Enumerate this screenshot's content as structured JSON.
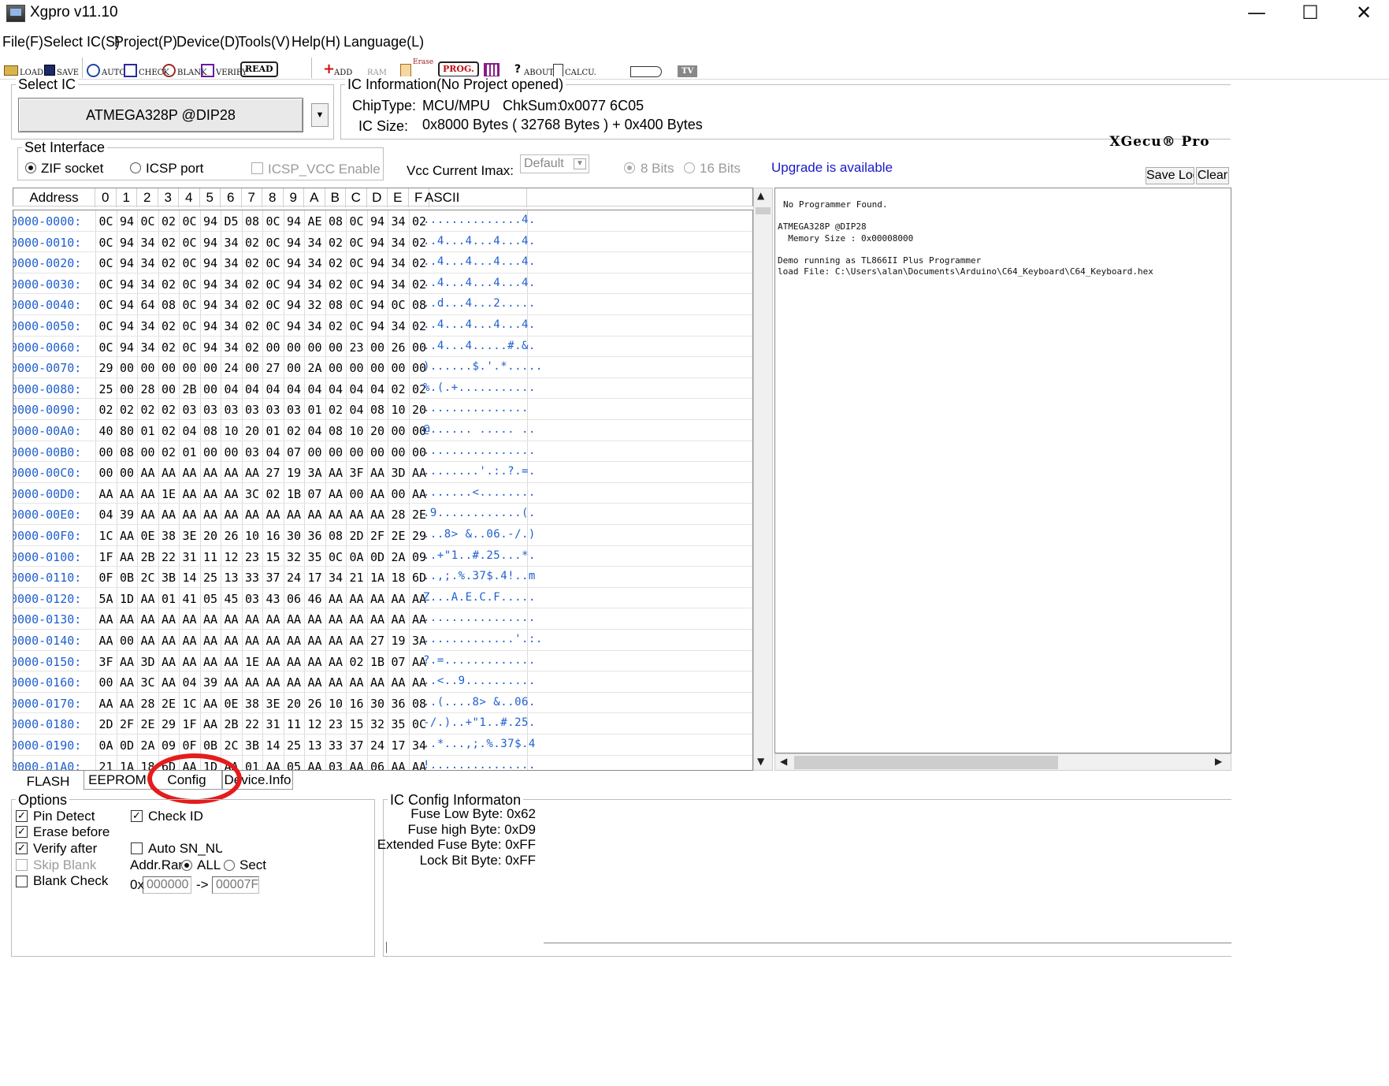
{
  "window": {
    "title": "Xgpro v11.10",
    "min": "—",
    "max": "☐",
    "close": "✕"
  },
  "menu": [
    "File(F)",
    "Select IC(S)",
    "Project(P)",
    "Device(D)",
    "Tools(V)",
    "Help(H)",
    "Language(L)"
  ],
  "toolbar": {
    "load": "LOAD",
    "save": "SAVE",
    "auto": "AUTO",
    "check": "CHECK",
    "blank": "BLANK",
    "verify": "VERIFY",
    "read": "READ",
    "add": "ADD",
    "ram": "RAM",
    "erase": "Erase",
    "prog": "PROG.",
    "about": "ABOUT",
    "calcu": "CALCU.",
    "tv": "TV"
  },
  "select_ic": {
    "title": "Select IC",
    "device": "ATMEGA328P @DIP28",
    "arrow": "▼"
  },
  "ic_info": {
    "title": "IC Information(No Project opened)",
    "chiptype_label": "ChipType:",
    "chiptype": "MCU/MPU",
    "chksum_label": "ChkSum:",
    "chksum": "0x0077 6C05",
    "size_label": "IC Size:",
    "size": "0x8000 Bytes ( 32768 Bytes ) + 0x400 Bytes"
  },
  "brand": "XGecu® Pro",
  "interface": {
    "title": "Set Interface",
    "zif": "ZIF socket",
    "icsp": "ICSP port",
    "icsp_vcc": "ICSP_VCC Enable",
    "vcc_label": "Vcc Current Imax:",
    "vcc_value": "Default",
    "bits8": "8 Bits",
    "bits16": "16 Bits"
  },
  "upgrade": "Upgrade is available",
  "log_buttons": {
    "save": "Save Log",
    "clear": "Clear"
  },
  "hex": {
    "headers": [
      "Address",
      "0",
      "1",
      "2",
      "3",
      "4",
      "5",
      "6",
      "7",
      "8",
      "9",
      "A",
      "B",
      "C",
      "D",
      "E",
      "F",
      "ASCII"
    ],
    "rows": [
      {
        "addr": "0000-0000:",
        "bytes": [
          "0C",
          "94",
          "0C",
          "02",
          "0C",
          "94",
          "D5",
          "08",
          "0C",
          "94",
          "AE",
          "08",
          "0C",
          "94",
          "34",
          "02"
        ],
        "ascii": "..............4."
      },
      {
        "addr": "0000-0010:",
        "bytes": [
          "0C",
          "94",
          "34",
          "02",
          "0C",
          "94",
          "34",
          "02",
          "0C",
          "94",
          "34",
          "02",
          "0C",
          "94",
          "34",
          "02"
        ],
        "ascii": "..4...4...4...4."
      },
      {
        "addr": "0000-0020:",
        "bytes": [
          "0C",
          "94",
          "34",
          "02",
          "0C",
          "94",
          "34",
          "02",
          "0C",
          "94",
          "34",
          "02",
          "0C",
          "94",
          "34",
          "02"
        ],
        "ascii": "..4...4...4...4."
      },
      {
        "addr": "0000-0030:",
        "bytes": [
          "0C",
          "94",
          "34",
          "02",
          "0C",
          "94",
          "34",
          "02",
          "0C",
          "94",
          "34",
          "02",
          "0C",
          "94",
          "34",
          "02"
        ],
        "ascii": "..4...4...4...4."
      },
      {
        "addr": "0000-0040:",
        "bytes": [
          "0C",
          "94",
          "64",
          "08",
          "0C",
          "94",
          "34",
          "02",
          "0C",
          "94",
          "32",
          "08",
          "0C",
          "94",
          "0C",
          "08"
        ],
        "ascii": "..d...4...2....."
      },
      {
        "addr": "0000-0050:",
        "bytes": [
          "0C",
          "94",
          "34",
          "02",
          "0C",
          "94",
          "34",
          "02",
          "0C",
          "94",
          "34",
          "02",
          "0C",
          "94",
          "34",
          "02"
        ],
        "ascii": "..4...4...4...4."
      },
      {
        "addr": "0000-0060:",
        "bytes": [
          "0C",
          "94",
          "34",
          "02",
          "0C",
          "94",
          "34",
          "02",
          "00",
          "00",
          "00",
          "00",
          "23",
          "00",
          "26",
          "00"
        ],
        "ascii": "..4...4.....#.&."
      },
      {
        "addr": "0000-0070:",
        "bytes": [
          "29",
          "00",
          "00",
          "00",
          "00",
          "00",
          "24",
          "00",
          "27",
          "00",
          "2A",
          "00",
          "00",
          "00",
          "00",
          "00"
        ],
        "ascii": ")......$.'.*....."
      },
      {
        "addr": "0000-0080:",
        "bytes": [
          "25",
          "00",
          "28",
          "00",
          "2B",
          "00",
          "04",
          "04",
          "04",
          "04",
          "04",
          "04",
          "04",
          "04",
          "02",
          "02"
        ],
        "ascii": "%.(.+..........."
      },
      {
        "addr": "0000-0090:",
        "bytes": [
          "02",
          "02",
          "02",
          "02",
          "03",
          "03",
          "03",
          "03",
          "03",
          "03",
          "01",
          "02",
          "04",
          "08",
          "10",
          "20"
        ],
        "ascii": "............... "
      },
      {
        "addr": "0000-00A0:",
        "bytes": [
          "40",
          "80",
          "01",
          "02",
          "04",
          "08",
          "10",
          "20",
          "01",
          "02",
          "04",
          "08",
          "10",
          "20",
          "00",
          "00"
        ],
        "ascii": "@...... ..... .."
      },
      {
        "addr": "0000-00B0:",
        "bytes": [
          "00",
          "08",
          "00",
          "02",
          "01",
          "00",
          "00",
          "03",
          "04",
          "07",
          "00",
          "00",
          "00",
          "00",
          "00",
          "00"
        ],
        "ascii": "................"
      },
      {
        "addr": "0000-00C0:",
        "bytes": [
          "00",
          "00",
          "AA",
          "AA",
          "AA",
          "AA",
          "AA",
          "AA",
          "27",
          "19",
          "3A",
          "AA",
          "3F",
          "AA",
          "3D",
          "AA"
        ],
        "ascii": "........'.:.?.=."
      },
      {
        "addr": "0000-00D0:",
        "bytes": [
          "AA",
          "AA",
          "AA",
          "1E",
          "AA",
          "AA",
          "AA",
          "3C",
          "02",
          "1B",
          "07",
          "AA",
          "00",
          "AA",
          "00",
          "AA"
        ],
        "ascii": ".......<........"
      },
      {
        "addr": "0000-00E0:",
        "bytes": [
          "04",
          "39",
          "AA",
          "AA",
          "AA",
          "AA",
          "AA",
          "AA",
          "AA",
          "AA",
          "AA",
          "AA",
          "AA",
          "AA",
          "28",
          "2E"
        ],
        "ascii": ".9............(."
      },
      {
        "addr": "0000-00F0:",
        "bytes": [
          "1C",
          "AA",
          "0E",
          "38",
          "3E",
          "20",
          "26",
          "10",
          "16",
          "30",
          "36",
          "08",
          "2D",
          "2F",
          "2E",
          "29"
        ],
        "ascii": "...8> &..06.-/.)"
      },
      {
        "addr": "0000-0100:",
        "bytes": [
          "1F",
          "AA",
          "2B",
          "22",
          "31",
          "11",
          "12",
          "23",
          "15",
          "32",
          "35",
          "0C",
          "0A",
          "0D",
          "2A",
          "09"
        ],
        "ascii": "..+\"1..#.25...*."
      },
      {
        "addr": "0000-0110:",
        "bytes": [
          "0F",
          "0B",
          "2C",
          "3B",
          "14",
          "25",
          "13",
          "33",
          "37",
          "24",
          "17",
          "34",
          "21",
          "1A",
          "18",
          "6D"
        ],
        "ascii": "..,;.%.37$.4!..m"
      },
      {
        "addr": "0000-0120:",
        "bytes": [
          "5A",
          "1D",
          "AA",
          "01",
          "41",
          "05",
          "45",
          "03",
          "43",
          "06",
          "46",
          "AA",
          "AA",
          "AA",
          "AA",
          "AA"
        ],
        "ascii": "Z...A.E.C.F....."
      },
      {
        "addr": "0000-0130:",
        "bytes": [
          "AA",
          "AA",
          "AA",
          "AA",
          "AA",
          "AA",
          "AA",
          "AA",
          "AA",
          "AA",
          "AA",
          "AA",
          "AA",
          "AA",
          "AA",
          "AA"
        ],
        "ascii": "................"
      },
      {
        "addr": "0000-0140:",
        "bytes": [
          "AA",
          "00",
          "AA",
          "AA",
          "AA",
          "AA",
          "AA",
          "AA",
          "AA",
          "AA",
          "AA",
          "AA",
          "AA",
          "27",
          "19",
          "3A"
        ],
        "ascii": ".............'.:."
      },
      {
        "addr": "0000-0150:",
        "bytes": [
          "3F",
          "AA",
          "3D",
          "AA",
          "AA",
          "AA",
          "AA",
          "1E",
          "AA",
          "AA",
          "AA",
          "AA",
          "02",
          "1B",
          "07",
          "AA"
        ],
        "ascii": "?.=............."
      },
      {
        "addr": "0000-0160:",
        "bytes": [
          "00",
          "AA",
          "3C",
          "AA",
          "04",
          "39",
          "AA",
          "AA",
          "AA",
          "AA",
          "AA",
          "AA",
          "AA",
          "AA",
          "AA",
          "AA"
        ],
        "ascii": "..<..9.........."
      },
      {
        "addr": "0000-0170:",
        "bytes": [
          "AA",
          "AA",
          "28",
          "2E",
          "1C",
          "AA",
          "0E",
          "38",
          "3E",
          "20",
          "26",
          "10",
          "16",
          "30",
          "36",
          "08"
        ],
        "ascii": "..(....8> &..06."
      },
      {
        "addr": "0000-0180:",
        "bytes": [
          "2D",
          "2F",
          "2E",
          "29",
          "1F",
          "AA",
          "2B",
          "22",
          "31",
          "11",
          "12",
          "23",
          "15",
          "32",
          "35",
          "0C"
        ],
        "ascii": "-/.)..+\"1..#.25."
      },
      {
        "addr": "0000-0190:",
        "bytes": [
          "0A",
          "0D",
          "2A",
          "09",
          "0F",
          "0B",
          "2C",
          "3B",
          "14",
          "25",
          "13",
          "33",
          "37",
          "24",
          "17",
          "34"
        ],
        "ascii": "..*...,;.%.37$.4"
      },
      {
        "addr": "0000-01A0:",
        "bytes": [
          "21",
          "1A",
          "18",
          "6D",
          "AA",
          "1D",
          "AA",
          "01",
          "AA",
          "05",
          "AA",
          "03",
          "AA",
          "06",
          "AA",
          "AA"
        ],
        "ascii": "!..............."
      }
    ]
  },
  "log": [
    "No Programmer Found.",
    "",
    "ATMEGA328P @DIP28",
    "  Memory Size : 0x00008000",
    "",
    "Demo running as TL866II Plus Programmer",
    "load File: C:\\Users\\alan\\Documents\\Arduino\\C64_Keyboard\\C64_Keyboard.hex"
  ],
  "tabs": [
    "FLASH",
    "EEPROM",
    "Config",
    "Device.Info"
  ],
  "options": {
    "title": "Options",
    "pin_detect": "Pin Detect",
    "check_id": "Check ID",
    "erase_before": "Erase before",
    "verify_after": "Verify after",
    "auto_sn": "Auto SN_NUM",
    "skip_blank": "Skip Blank",
    "addr_range": "Addr.Ran",
    "all": "ALL",
    "sect": "Sect",
    "blank_check": "Blank Check",
    "hex_prefix": "0x",
    "start": "000000",
    "arrow": "->",
    "end": "00007F",
    "checkmark": "✓"
  },
  "config_info": {
    "title": "IC Config Informaton",
    "fuse_low": "Fuse Low Byte: 0x62",
    "fuse_high": "Fuse high Byte: 0xD9",
    "ext_fuse": "Extended Fuse Byte: 0xFF",
    "lock": "Lock Bit Byte: 0xFF"
  }
}
